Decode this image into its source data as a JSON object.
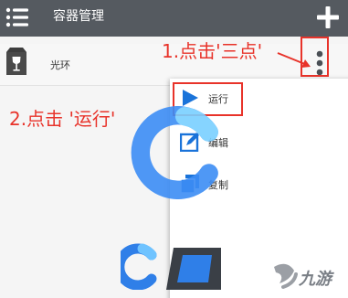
{
  "header": {
    "title": "容器管理",
    "menu_icon": "hamburger-icon",
    "add_icon": "plus-icon",
    "background": "#555a60"
  },
  "container": {
    "name": "光环",
    "icon": "wine-glass-icon",
    "more_icon": "three-dots-vertical-icon"
  },
  "annotations": {
    "step1": "1.点击'三点'",
    "step2": "2.点击 '运行'",
    "color": "#e8332a"
  },
  "popup_menu": {
    "items": [
      {
        "label": "运行",
        "icon": "play-icon"
      },
      {
        "label": "编辑",
        "icon": "edit-icon"
      },
      {
        "label": "复制",
        "icon": "copy-icon"
      }
    ]
  },
  "watermark": {
    "site": "九游",
    "accent": "#3d8df5"
  }
}
